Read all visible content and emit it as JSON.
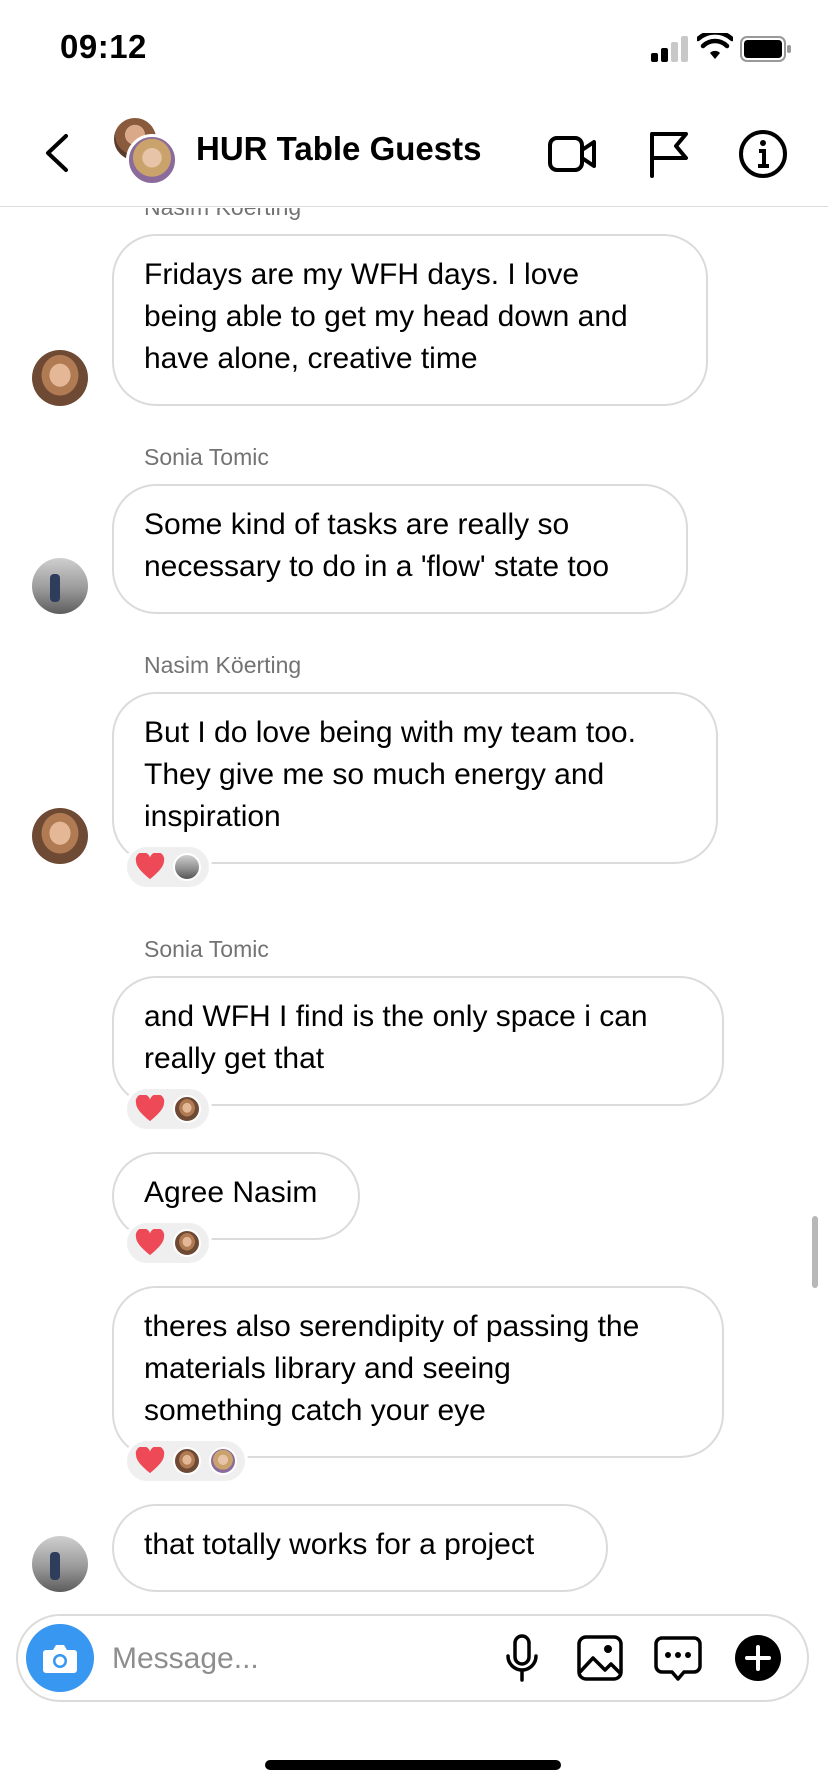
{
  "status_bar": {
    "time": "09:12"
  },
  "header": {
    "title": "HUR Table Guests",
    "back_icon": "chevron-left-icon",
    "video_icon": "video-camera-icon",
    "flag_icon": "flag-icon",
    "info_icon": "info-icon"
  },
  "messages": [
    {
      "sender": "Nasim Köerting",
      "text_lines": [
        "Fridays are my WFH days. I love",
        "being able to get my head down and",
        "have alone, creative time"
      ]
    },
    {
      "sender": "Sonia Tomic",
      "text_lines": [
        "Some kind of tasks are really so",
        "necessary to do in a 'flow' state too"
      ]
    },
    {
      "sender": "Nasim Köerting",
      "text_lines": [
        "But I do love being with my team too.",
        "They give me so much energy and",
        "inspiration"
      ],
      "reactions": [
        "heart"
      ]
    },
    {
      "sender": "Sonia Tomic",
      "text_lines": [
        "and WFH I find is the only space i can",
        "really get that"
      ],
      "reactions": [
        "heart"
      ]
    },
    {
      "text_lines": [
        "Agree Nasim"
      ],
      "reactions": [
        "heart"
      ]
    },
    {
      "text_lines": [
        "theres also serendipity of passing the",
        "materials library and seeing",
        "something catch your eye"
      ],
      "reactions": [
        "heart"
      ]
    },
    {
      "text_lines": [
        "that totally works for a project"
      ]
    }
  ],
  "composer": {
    "placeholder": "Message...",
    "camera_icon": "camera-icon",
    "mic_icon": "microphone-icon",
    "gallery_icon": "image-icon",
    "sticker_icon": "message-bubble-icon",
    "plus_icon": "plus-icon"
  },
  "colors": {
    "accent": "#3897f0",
    "heart": "#ed4956",
    "bubble_border": "#dbdbdb"
  }
}
